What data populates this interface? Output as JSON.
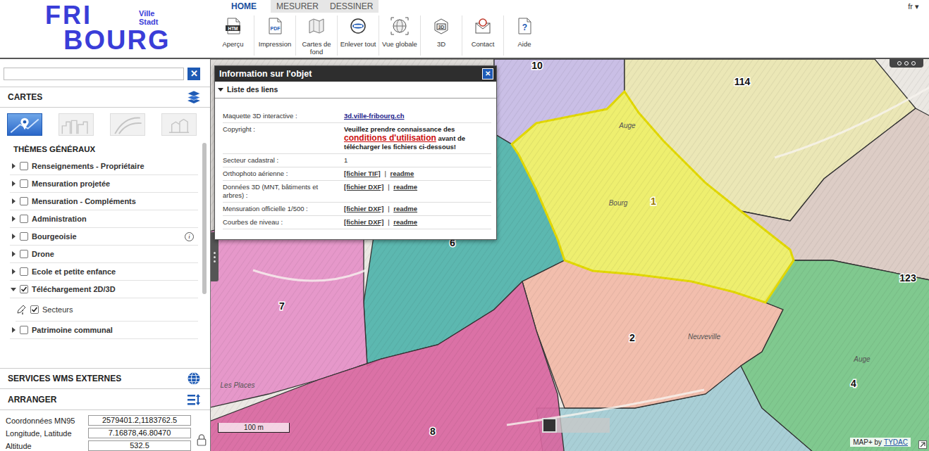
{
  "logo": {
    "top": "FRI",
    "bottom": "BOURG",
    "sub1": "Ville",
    "sub2": "Stadt"
  },
  "tabs": [
    {
      "label": "HOME",
      "selected": true
    },
    {
      "label": "MESURER",
      "selected": false
    },
    {
      "label": "DESSINER",
      "selected": false
    }
  ],
  "toolbar": [
    {
      "label": "Aperçu",
      "kind": "html",
      "badge": "HTM"
    },
    {
      "label": "Impression",
      "kind": "pdf",
      "badge": "PDF"
    },
    {
      "label": "Cartes de fond",
      "kind": "basemap"
    },
    {
      "label": "Enlever tout",
      "kind": "clear"
    },
    {
      "label": "Vue globale",
      "kind": "globe"
    },
    {
      "label": "3D",
      "kind": "cube",
      "badge": "3D"
    },
    {
      "label": "Contact",
      "kind": "mail"
    },
    {
      "label": "Aide",
      "kind": "help",
      "badge": "?"
    }
  ],
  "language": {
    "value": "fr",
    "arrow": "▾"
  },
  "search": {
    "value": "",
    "clear": "✕"
  },
  "cartes": {
    "title": "CARTES",
    "thumbnails": [
      {
        "kind": "map",
        "selected": true
      },
      {
        "kind": "city",
        "selected": false
      },
      {
        "kind": "aerial",
        "selected": false
      },
      {
        "kind": "blocks",
        "selected": false
      }
    ]
  },
  "themes": {
    "title": "THÈMES GÉNÉRAUX",
    "items": [
      {
        "label": "Renseignements - Propriétaire",
        "expanded": false,
        "checked": false
      },
      {
        "label": "Mensuration projetée",
        "expanded": false,
        "checked": false
      },
      {
        "label": "Mensuration - Compléments",
        "expanded": false,
        "checked": false
      },
      {
        "label": "Administration",
        "expanded": false,
        "checked": false
      },
      {
        "label": "Bourgeoisie",
        "expanded": false,
        "checked": false,
        "info": "i"
      },
      {
        "label": "Drone",
        "expanded": false,
        "checked": false
      },
      {
        "label": "Ecole et petite enfance",
        "expanded": false,
        "checked": false
      },
      {
        "label": "Téléchargement 2D/3D",
        "expanded": true,
        "checked": true,
        "children": [
          {
            "label": "Secteurs",
            "checked": true
          }
        ]
      },
      {
        "label": "Patrimoine communal",
        "expanded": false,
        "checked": false
      }
    ]
  },
  "wms": {
    "title": "SERVICES WMS EXTERNES"
  },
  "arranger": {
    "title": "ARRANGER"
  },
  "coordinates": [
    {
      "label": "Coordonnées MN95",
      "value": "2579401.2,1183762.5"
    },
    {
      "label": "Longitude, Latitude",
      "value": "7.16878,46.80470"
    },
    {
      "label": "Altitude",
      "value": "532.5"
    }
  ],
  "sectors": [
    {
      "label": "10",
      "color": "#c7bae6",
      "selected": false
    },
    {
      "label": "114",
      "color": "#ebe7b0",
      "selected": false
    },
    {
      "label": "1",
      "color": "#eef05a",
      "selected": true
    },
    {
      "label": "6",
      "color": "#4db3aa",
      "selected": false
    },
    {
      "label": "7",
      "color": "#e68fc6",
      "selected": false
    },
    {
      "label": "2",
      "color": "#f3b9a6",
      "selected": false
    },
    {
      "label": "123",
      "color": "#dccac2",
      "selected": false
    },
    {
      "label": "4",
      "color": "#74c585",
      "selected": false
    },
    {
      "label": "8",
      "color": "#d9649f",
      "selected": false
    }
  ],
  "places": [
    "Auge",
    "Bourg",
    "Neuveville",
    "Auge",
    "Les Places"
  ],
  "scale": "100 m",
  "credit": {
    "text": "MAP+ by",
    "link": "TYDAC"
  },
  "popup": {
    "title": "Information sur l'objet",
    "close": "✕",
    "section": "Liste des liens",
    "expanded": true,
    "rows": [
      {
        "label": "Maquette 3D interactive :",
        "kind": "link",
        "value": "3d.ville-fribourg.ch"
      },
      {
        "label": "Copyright :",
        "kind": "notice",
        "before": "Veuillez prendre connaissance des",
        "link": "conditions d'utilisation",
        "after": "avant de télécharger les fichiers ci-dessous!"
      },
      {
        "label": "Secteur cadastral :",
        "kind": "text",
        "value": "1"
      },
      {
        "label": "Orthophoto aérienne :",
        "kind": "files",
        "file": "[fichier TIF]",
        "sep": "|",
        "readme": "readme"
      },
      {
        "label": "Données 3D (MNT, bâtiments et arbres) :",
        "kind": "files",
        "file": "[fichier DXF]",
        "sep": "|",
        "readme": "readme"
      },
      {
        "label": "Mensuration officielle 1/500 :",
        "kind": "files",
        "file": "[fichier DXF]",
        "sep": "|",
        "readme": "readme"
      },
      {
        "label": "Courbes de niveau :",
        "kind": "files",
        "file": "[fichier DXF]",
        "sep": "|",
        "readme": "readme"
      }
    ]
  }
}
